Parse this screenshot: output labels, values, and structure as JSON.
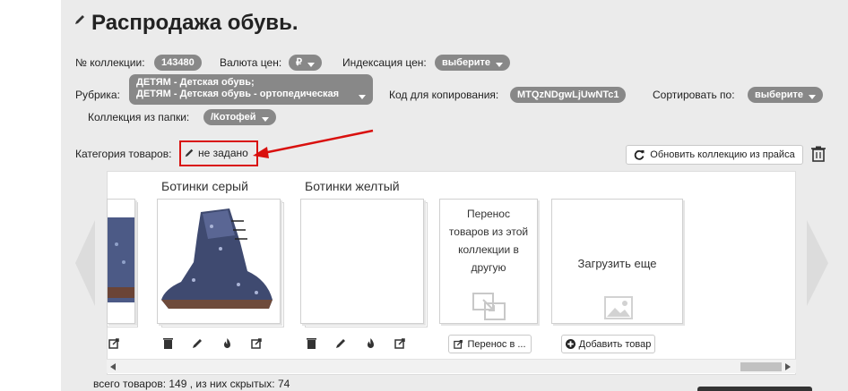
{
  "title": "Распродажа обувь.",
  "fields": {
    "collection_no_label": "№ коллекции:",
    "collection_no": "143480",
    "currency_label": "Валюта цен:",
    "currency": "₽",
    "indexing_label": "Индексация цен:",
    "indexing": "выберите",
    "rubric_label": "Рубрика:",
    "rubric_line1": "ДЕТЯМ - Детская обувь;",
    "rubric_line2": "ДЕТЯМ - Детская обувь - ортопедическая",
    "copy_code_label": "Код для копирования:",
    "copy_code": "MTQzNDgwLjUwNTc1",
    "sort_label": "Сортировать по:",
    "sort": "выберите",
    "folder_label": "Коллекция из папки:",
    "folder": "/Котофей",
    "category_label": "Категория товаров:",
    "category": "не задано"
  },
  "buttons": {
    "refresh": "Обновить коллекцию из прайса",
    "move": "Перенос в ...",
    "add": "Добавить товар"
  },
  "items": [
    {
      "title": "Ботинки серый"
    },
    {
      "title": "Ботинки желтый"
    }
  ],
  "cards": {
    "move_text_1": "Перенос",
    "move_text_2": "товаров из этой",
    "move_text_3": "коллекции в",
    "move_text_4": "другую",
    "load_more": "Загрузить еще"
  },
  "footer": {
    "total": "всего товаров: 149 , из них скрытых: 74"
  },
  "colors": {
    "pill": "#888888",
    "highlight": "#d9100e",
    "panel": "#ebebeb"
  }
}
